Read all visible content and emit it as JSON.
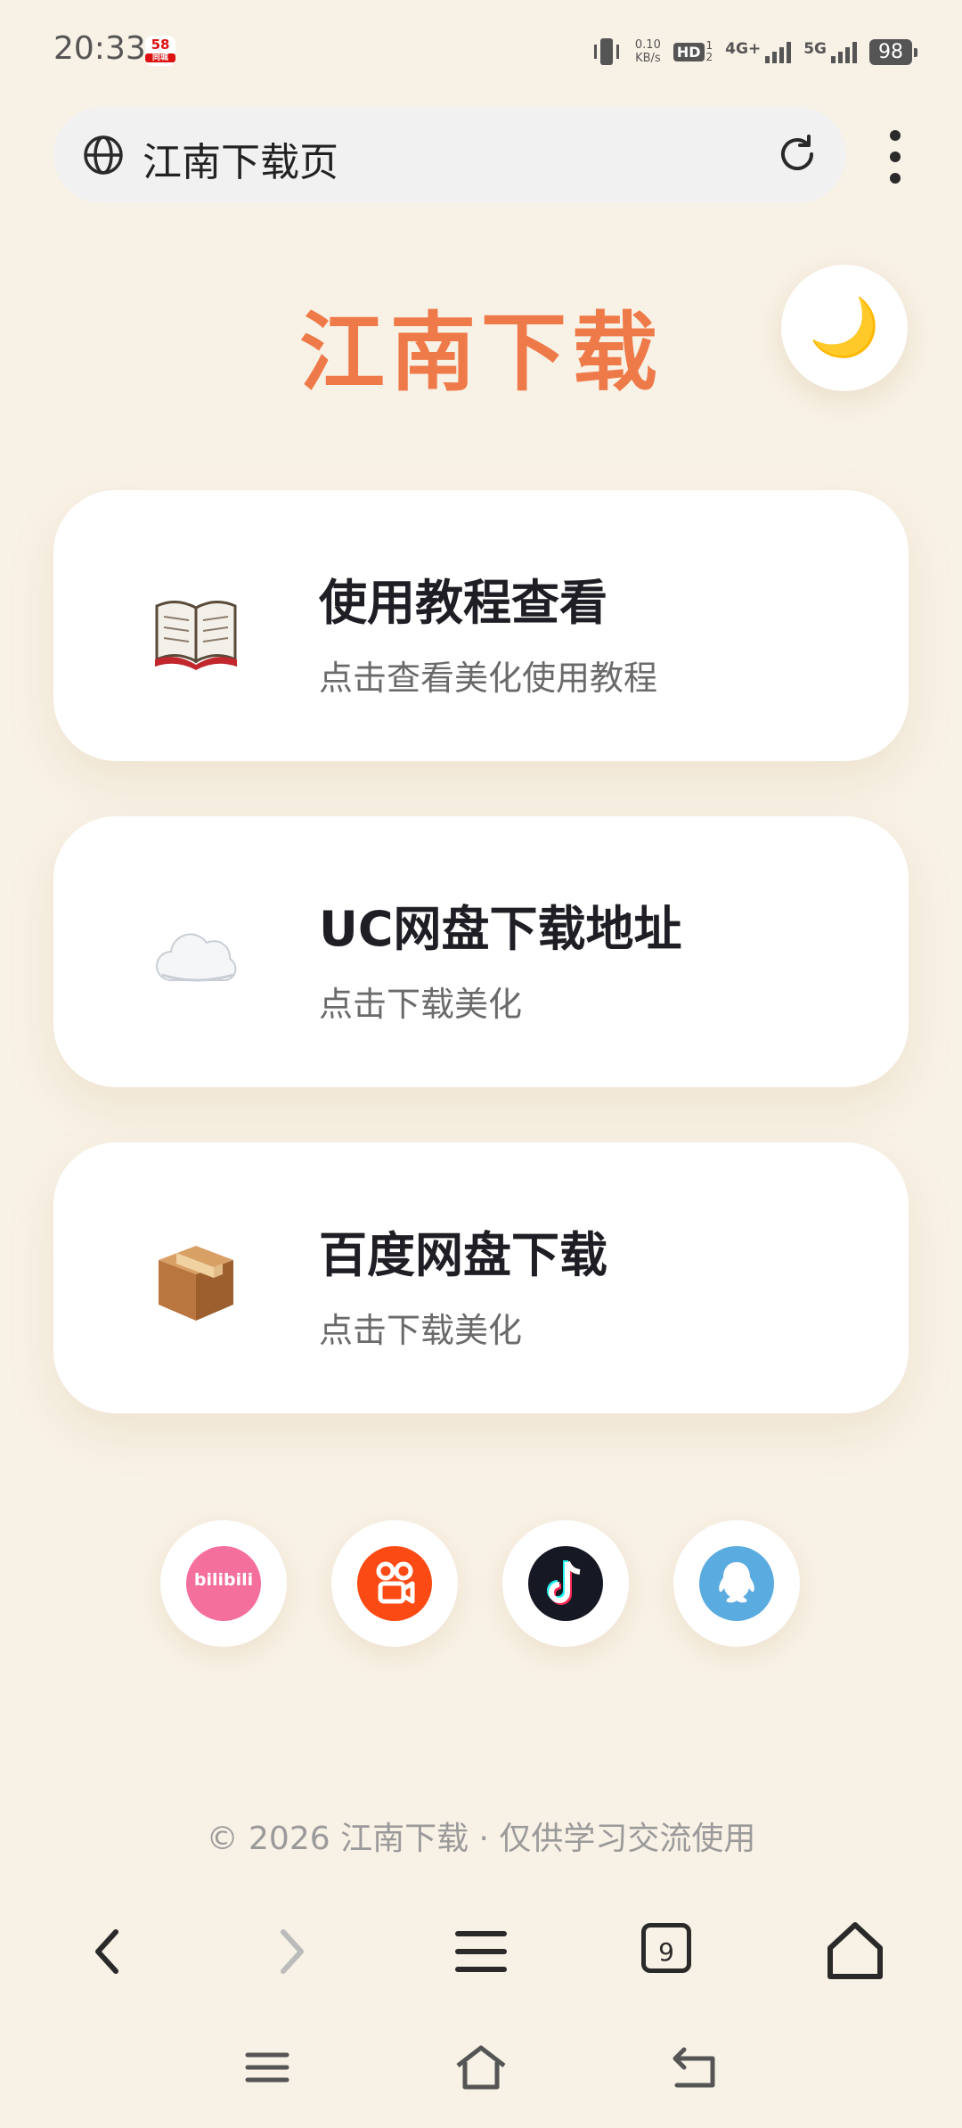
{
  "status": {
    "time": "20:33",
    "app_badge": "58",
    "app_badge_sub": "同城",
    "net_speed_top": "0.10",
    "net_speed_unit": "KB/s",
    "hd_label": "HD",
    "hd_sup": "1",
    "hd_sub": "2",
    "sig1_label": "4G+",
    "sig2_label": "5G",
    "battery": "98"
  },
  "urlbar": {
    "title": "江南下载页"
  },
  "page": {
    "title": "江南下载",
    "theme_toggle_icon": "🌙"
  },
  "cards": [
    {
      "icon": "📖",
      "title": "使用教程查看",
      "subtitle": "点击查看美化使用教程"
    },
    {
      "icon": "☁️",
      "title": "UC网盘下载地址",
      "subtitle": "点击下载美化"
    },
    {
      "icon": "📦",
      "title": "百度网盘下载",
      "subtitle": "点击下载美化"
    }
  ],
  "social": [
    {
      "name": "bilibili-icon",
      "label": "bilibili",
      "color": "#f56f9c"
    },
    {
      "name": "kuaishou-icon",
      "label": "",
      "color": "#fc4a14"
    },
    {
      "name": "douyin-icon",
      "label": "",
      "color": "#161823"
    },
    {
      "name": "qq-icon",
      "label": "",
      "color": "#5aabe0"
    }
  ],
  "footer": {
    "text": "© 2026 江南下载 · 仅供学习交流使用"
  },
  "browser_nav": {
    "tab_count": "9"
  },
  "colors": {
    "accent": "#ee7a4a",
    "background": "#f8f1e5"
  }
}
